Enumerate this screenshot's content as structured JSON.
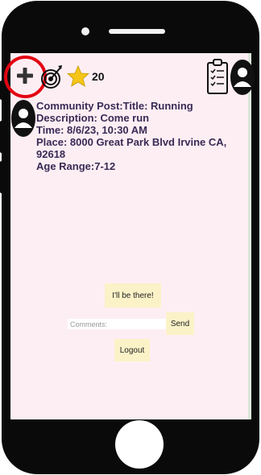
{
  "header": {
    "points": "20"
  },
  "post": {
    "lines": [
      "Community Post:Title: Running",
      "Description: Come run",
      "Time: 8/6/23, 10:30 AM",
      "Place: 8000 Great Park Blvd Irvine CA, 92618",
      "Age Range:7-12"
    ]
  },
  "actions": {
    "attend_label": "I'll be there!",
    "comment_placeholder": "Comments:",
    "comment_value": "",
    "send_label": "Send",
    "logout_label": "Logout"
  },
  "icons": {
    "add": "plus-icon",
    "goals": "target-icon",
    "points": "star-icon",
    "tasks": "clipboard-icon",
    "profile": "user-avatar-icon"
  },
  "colors": {
    "screen_bg": "#fdeef4",
    "button_bg": "#fbf2c7",
    "highlight_ring": "#e30613",
    "star": "#f5c518",
    "post_text": "#3a2a55"
  }
}
